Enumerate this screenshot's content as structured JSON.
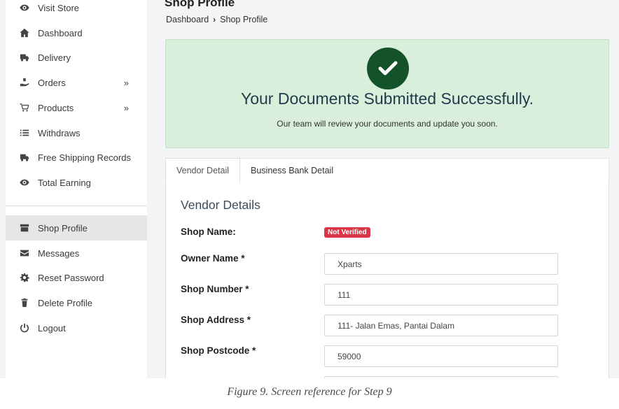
{
  "sidebar": {
    "items": [
      {
        "label": "Visit Store",
        "icon": "eye-icon"
      },
      {
        "label": "Dashboard",
        "icon": "home-icon"
      },
      {
        "label": "Delivery",
        "icon": "truck-icon"
      },
      {
        "label": "Orders",
        "icon": "hand-box-icon",
        "chevron": "»"
      },
      {
        "label": "Products",
        "icon": "cart-icon",
        "chevron": "»"
      },
      {
        "label": "Withdraws",
        "icon": "list-icon"
      },
      {
        "label": "Free Shipping Records",
        "icon": "truck-icon"
      },
      {
        "label": "Total Earning",
        "icon": "eye-icon"
      },
      {
        "label": "Shop Profile",
        "icon": "store-icon",
        "active": true
      },
      {
        "label": "Messages",
        "icon": "envelope-icon"
      },
      {
        "label": "Reset Password",
        "icon": "gear-icon"
      },
      {
        "label": "Delete Profile",
        "icon": "trash-icon"
      },
      {
        "label": "Logout",
        "icon": "power-icon"
      }
    ]
  },
  "header": {
    "title": "Shop Profile",
    "breadcrumb": {
      "root": "Dashboard",
      "separator": "›",
      "current": "Shop Profile"
    }
  },
  "alert": {
    "title": "Your Documents Submitted Successfully.",
    "message": "Our team will review your documents and update you soon.",
    "icon": "check-circle-icon",
    "color_bg": "#d9efdc",
    "color_icon": "#14532a"
  },
  "tabs": [
    {
      "label": "Vendor Detail",
      "active": true
    },
    {
      "label": "Business Bank Detail",
      "active": false
    }
  ],
  "vendor": {
    "section_title": "Vendor Details",
    "shop_name_label": "Shop Name:",
    "shop_name_status": "Not Verified",
    "owner_name_label": "Owner Name *",
    "owner_name_value": "Xparts",
    "shop_number_label": "Shop Number *",
    "shop_number_value": "111",
    "shop_address_label": "Shop Address *",
    "shop_address_value": "111- Jalan Emas, Pantai Dalam",
    "shop_postcode_label": "Shop Postcode *",
    "shop_postcode_value": "59000",
    "status_color": "#d9364a"
  },
  "caption": "Figure 9. Screen reference for Step 9"
}
